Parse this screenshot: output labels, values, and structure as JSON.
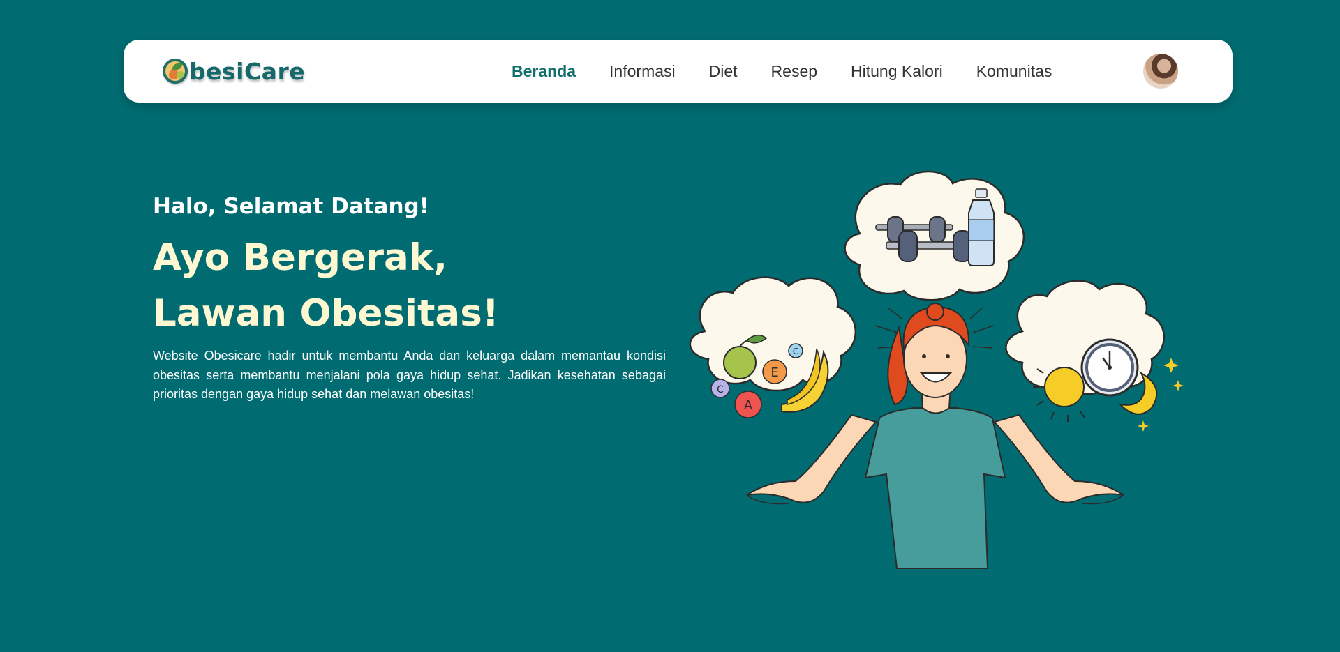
{
  "app": {
    "brand_name": "ObesiCare",
    "brand_text": "besiCare",
    "accent_color": "#006b70",
    "headline_color": "#fdf7d2"
  },
  "navbar": {
    "items": [
      {
        "label": "Beranda",
        "active": true
      },
      {
        "label": "Informasi",
        "active": false
      },
      {
        "label": "Diet",
        "active": false
      },
      {
        "label": "Resep",
        "active": false
      },
      {
        "label": "Hitung Kalori",
        "active": false
      },
      {
        "label": "Komunitas",
        "active": false
      }
    ],
    "avatar_icon": "user-avatar"
  },
  "hero": {
    "greeting": "Halo, Selamat Datang!",
    "headline_line1": "Ayo Bergerak,",
    "headline_line2": "Lawan Obesitas!",
    "description": "Website Obesicare hadir untuk membantu Anda dan keluarga dalam memantau kondisi obesitas serta membantu menjalani pola gaya hidup sehat. Jadikan kesehatan sebagai prioritas dengan gaya hidup sehat dan melawan obesitas!"
  },
  "illustration": {
    "vitamin_letters": [
      "C",
      "E",
      "C",
      "A"
    ]
  }
}
